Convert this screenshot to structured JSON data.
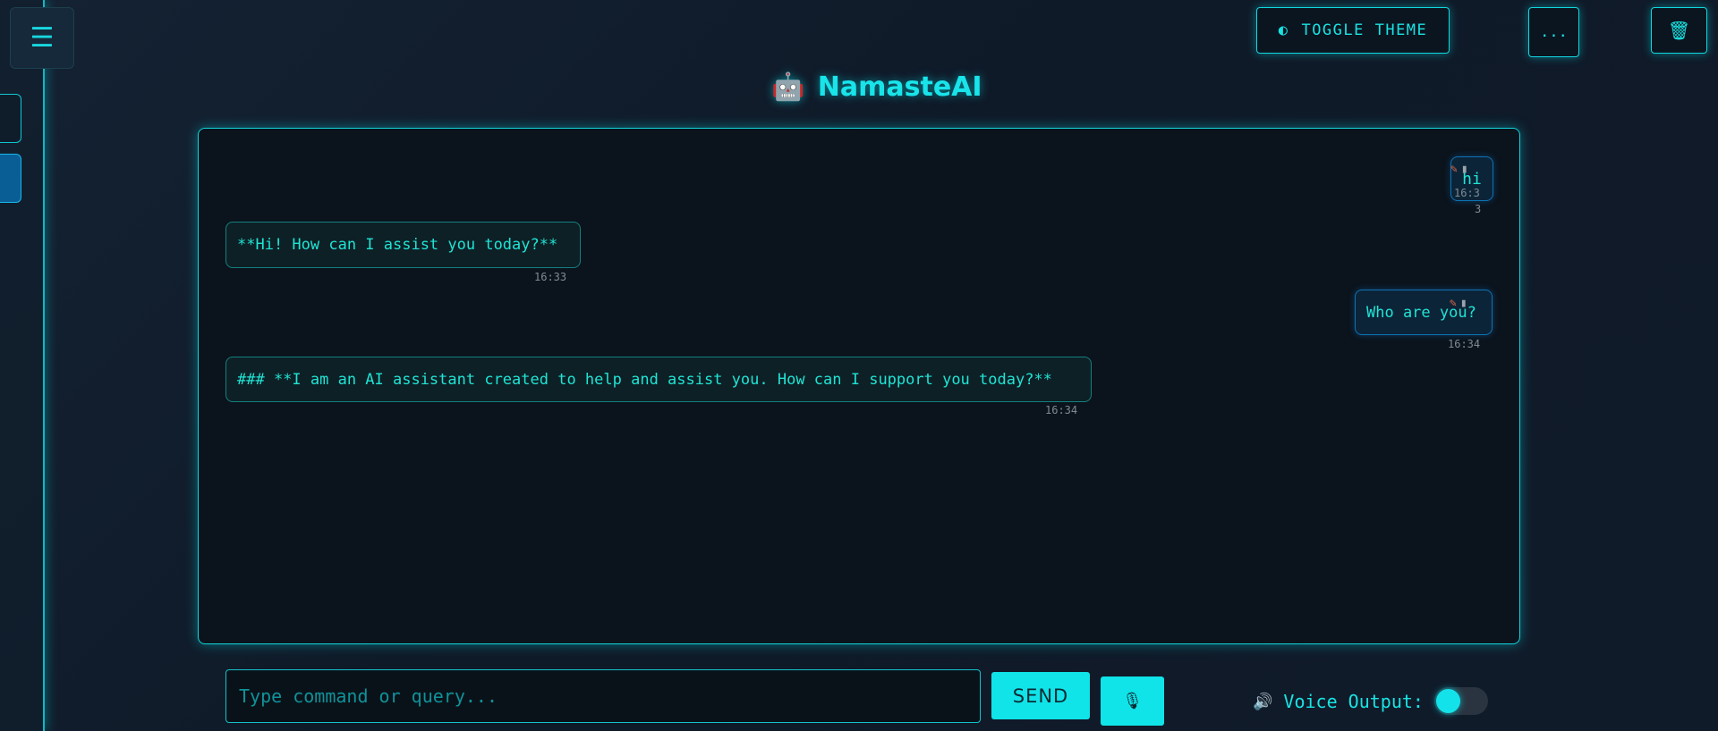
{
  "app": {
    "title": "NamasteAI",
    "title_icon": "robot-face-icon"
  },
  "header": {
    "menu_icon": "hamburger-menu-icon",
    "toggle_theme_label": "TOGGLE THEME",
    "more_label": "...",
    "trash_icon": "trash-icon"
  },
  "messages": [
    {
      "role": "user",
      "text": "hi",
      "time": "16:3",
      "time_wrap": "3"
    },
    {
      "role": "assistant",
      "text": "**Hi! How can I assist you today?**",
      "time": "16:33"
    },
    {
      "role": "user",
      "text": "Who are you?",
      "time": "16:34"
    },
    {
      "role": "assistant",
      "text": "### **I am an AI assistant created to help and assist you. How can I support you today?**",
      "time": "16:34"
    }
  ],
  "composer": {
    "placeholder": "Type command or query...",
    "value": "",
    "send_label": "SEND",
    "mic_icon": "microphone-icon"
  },
  "voice_output": {
    "label": "Voice Output:",
    "icon": "speaker-icon",
    "enabled": false
  },
  "colors": {
    "accent": "#13e0e6",
    "background": "#0f1a28",
    "user_bubble_border": "#0d73b6",
    "edit_icon": "#e06a4a"
  }
}
